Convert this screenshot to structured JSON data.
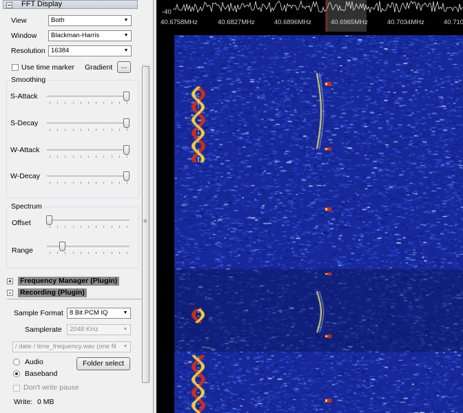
{
  "fft_display": {
    "title": "FFT Display",
    "view_label": "View",
    "view_value": "Both",
    "window_label": "Window",
    "window_value": "Blackman-Harris",
    "resolution_label": "Resolution",
    "resolution_value": "16384",
    "time_marker_label": "Use time marker",
    "time_marker_checked": false,
    "gradient_label": "Gradient",
    "gradient_button": "...",
    "smoothing": {
      "title": "Smoothing",
      "sliders": [
        {
          "label": "S-Attack",
          "value": 1.0
        },
        {
          "label": "S-Decay",
          "value": 1.0
        },
        {
          "label": "W-Attack",
          "value": 1.0
        },
        {
          "label": "W-Decay",
          "value": 1.0
        }
      ]
    },
    "spectrum": {
      "title": "Spectrum",
      "sliders": [
        {
          "label": "Offset",
          "value": 0.0
        },
        {
          "label": "Range",
          "value": 0.17
        }
      ]
    }
  },
  "plugins": {
    "frequency_manager": {
      "label": "Frequency Manager (Plugin)",
      "expand_symbol": "+"
    },
    "recording": {
      "label": "Recording (Plugin)",
      "expand_symbol": "-"
    }
  },
  "recording": {
    "sample_format_label": "Sample Format",
    "sample_format_value": "8 Bit PCM IQ",
    "samplerate_label": "Samplerate",
    "samplerate_value": "2048 KHz",
    "filename_value": "/ date / time_frequency.wav (one fil",
    "audio_label": "Audio",
    "baseband_label": "Baseband",
    "selected_mode": "baseband",
    "folder_button": "Folder select",
    "dont_write_pause_label": "Don't write pause",
    "write_label": "Write:",
    "write_value": "0 MB"
  },
  "spectrum_display": {
    "db_label": "-40",
    "freq_labels": [
      "40.6758MHz",
      "40.6827MHz",
      "40.6896MHz",
      "40.6965MHz",
      "40.7034MHz",
      "40.710"
    ]
  },
  "colors": {
    "waterfall_bg": "#17289a",
    "signal_red": "#c8301c",
    "signal_yellow": "#e8e060",
    "cursor_red": "#c02020"
  }
}
